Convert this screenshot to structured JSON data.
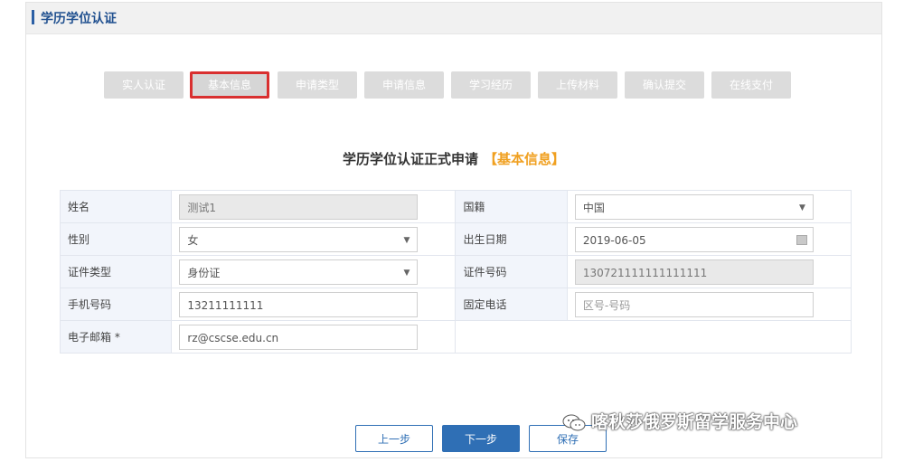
{
  "panel": {
    "title": "学历学位认证"
  },
  "steps": [
    "实人认证",
    "基本信息",
    "申请类型",
    "申请信息",
    "学习经历",
    "上传材料",
    "确认提交",
    "在线支付"
  ],
  "form": {
    "title": "学历学位认证正式申请",
    "subtitle": "【基本信息】",
    "name_label": "姓名",
    "name_value": "测试1",
    "nationality_label": "国籍",
    "nationality_value": "中国",
    "gender_label": "性别",
    "gender_value": "女",
    "birth_label": "出生日期",
    "birth_value": "2019-06-05",
    "idtype_label": "证件类型",
    "idtype_value": "身份证",
    "idnum_label": "证件号码",
    "idnum_value": "130721111111111111",
    "phone_label": "手机号码",
    "phone_value": "13211111111",
    "tel_label": "固定电话",
    "tel_placeholder": "区号-号码",
    "email_label": "电子邮箱 *",
    "email_value": "rz@cscse.edu.cn"
  },
  "buttons": {
    "prev": "上一步",
    "next": "下一步",
    "save": "保存"
  },
  "watermark": {
    "text": "喀秋莎俄罗斯留学服务中心"
  },
  "colors": {
    "accent": "#2f6fb5",
    "highlight": "#d93030",
    "subtitle": "#f0a020"
  }
}
